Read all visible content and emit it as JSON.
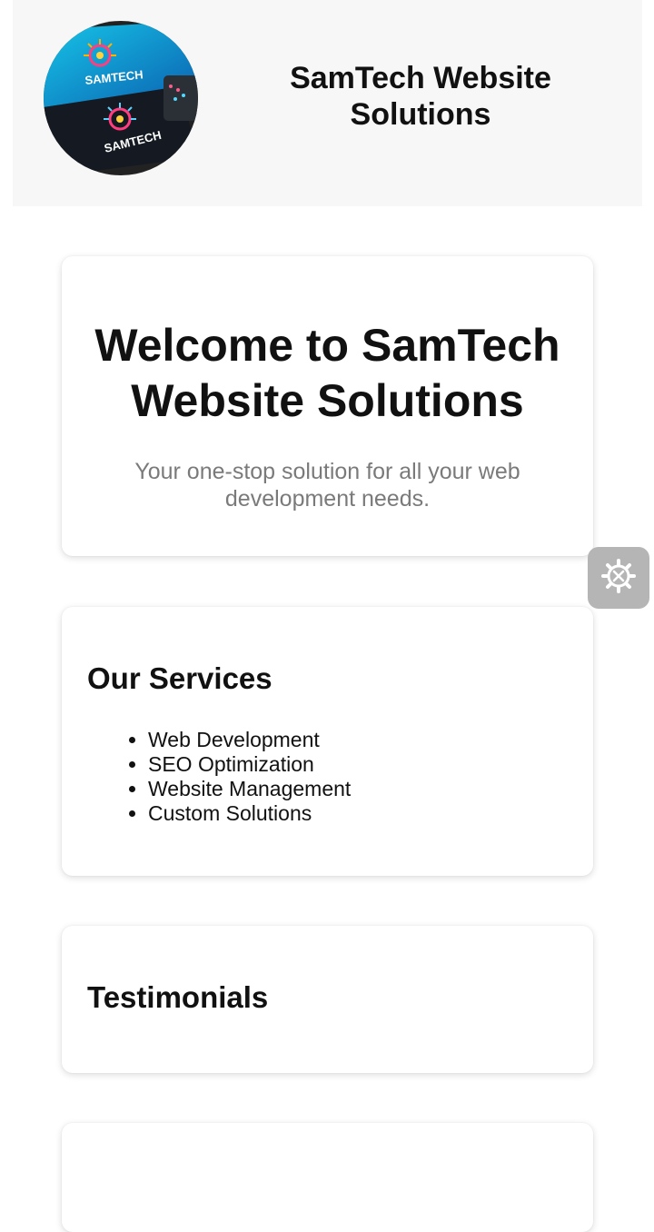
{
  "header": {
    "logo_text_top": "SAMTECH",
    "logo_text_bottom": "SAMTECH",
    "title": "SamTech Website Solutions"
  },
  "hero": {
    "heading": "Welcome to SamTech Website Solutions",
    "subtitle": "Your one-stop solution for all your web development needs."
  },
  "services": {
    "heading": "Our Services",
    "items": [
      "Web Development",
      "SEO Optimization",
      "Website Management",
      "Custom Solutions"
    ]
  },
  "testimonials": {
    "heading": "Testimonials"
  },
  "floating_button": {
    "icon": "settings-tools-icon"
  },
  "colors": {
    "header_bg": "#f7f7f7",
    "subtitle_text": "#7a7a7a",
    "fab_bg": "#b5b5b5",
    "logo_blue": "#1aa6e0"
  }
}
